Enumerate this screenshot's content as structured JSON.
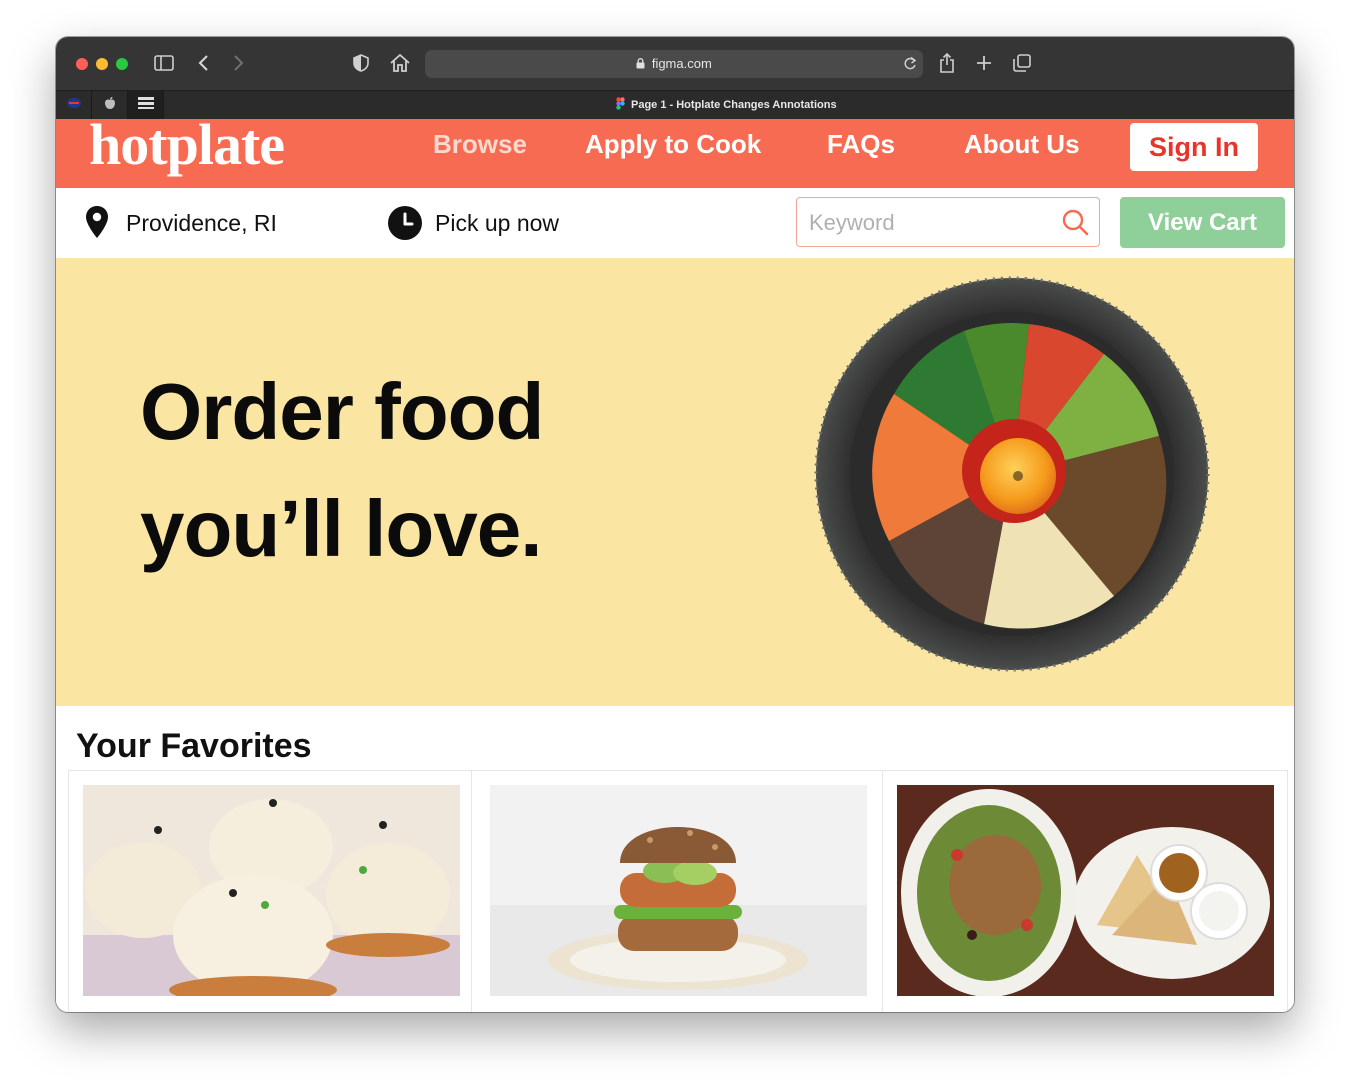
{
  "browser": {
    "url": "figma.com",
    "tab_title": "Page 1 - Hotplate Changes Annotations"
  },
  "nav": {
    "logo": "hotplate",
    "links": [
      "Browse",
      "Apply to Cook",
      "FAQs",
      "About Us"
    ],
    "sign_in": "Sign In"
  },
  "subbar": {
    "location": "Providence, RI",
    "pickup": "Pick up now",
    "search_placeholder": "Keyword",
    "view_cart": "View Cart"
  },
  "hero": {
    "line1": "Order food",
    "line2": "you’ll love."
  },
  "favorites": {
    "title": "Your Favorites",
    "items": [
      {
        "image": "soup-dumplings"
      },
      {
        "image": "veggie-burger"
      },
      {
        "image": "chicken-salad-pita"
      }
    ]
  },
  "colors": {
    "brand": "#f76b52",
    "hero_bg": "#fae5a3",
    "cart_green": "#8fcf9a",
    "sign_in_text": "#e8352c"
  }
}
